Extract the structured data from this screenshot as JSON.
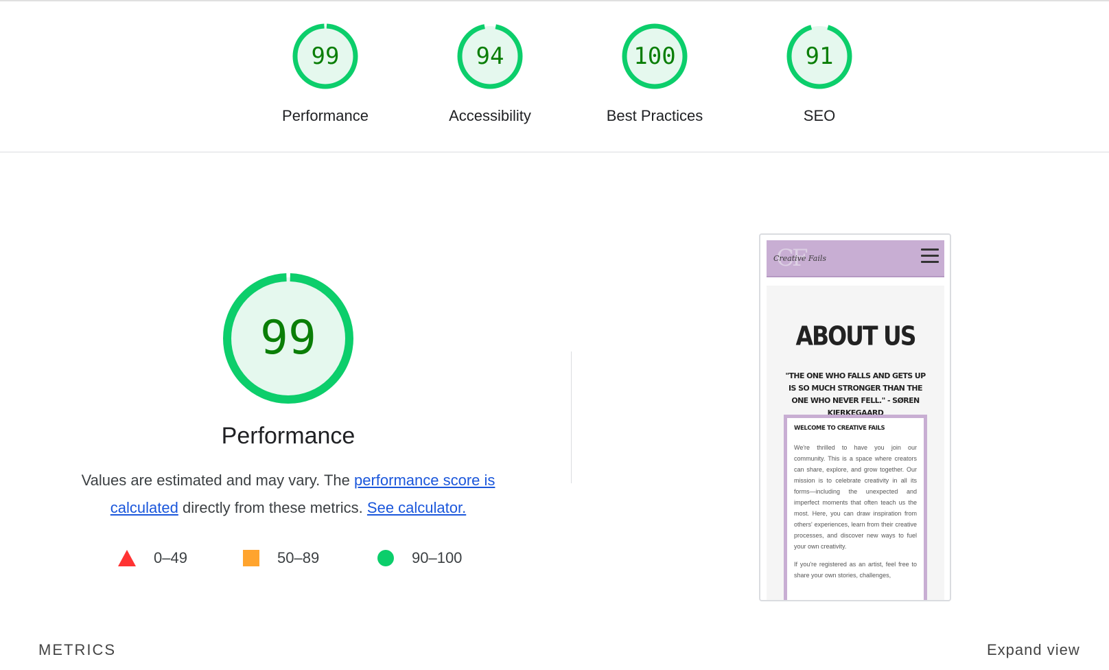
{
  "categories": [
    {
      "score": "99",
      "value": 99,
      "label": "Performance"
    },
    {
      "score": "94",
      "value": 94,
      "label": "Accessibility"
    },
    {
      "score": "100",
      "value": 100,
      "label": "Best Practices"
    },
    {
      "score": "91",
      "value": 91,
      "label": "SEO"
    }
  ],
  "colors": {
    "pass_ring": "#0cce6b",
    "pass_fill": "#e5f8ee",
    "pass_text": "#0a7e07",
    "fail": "#ff3333",
    "average": "#ffa42e",
    "link": "#1a56db"
  },
  "performance": {
    "score": "99",
    "value": 99,
    "title": "Performance",
    "desc_prefix": "Values are estimated and may vary. The ",
    "link_score": "performance score is calculated",
    "desc_middle": " directly from these metrics. ",
    "link_calculator": "See calculator."
  },
  "legend": [
    {
      "icon": "triangle-icon",
      "range": "0–49"
    },
    {
      "icon": "square-icon",
      "range": "50–89"
    },
    {
      "icon": "circle-icon",
      "range": "90–100"
    }
  ],
  "screenshot": {
    "logo_mono": "CF",
    "logo_script": "Creative Fails",
    "heading": "ABOUT US",
    "quote": "\"THE ONE WHO FALLS AND GETS UP IS SO MUCH STRONGER THAN THE ONE WHO NEVER FELL.\" - SØREN KIERKEGAARD",
    "card_title": "WELCOME TO CREATIVE FAILS",
    "card_body": "We're thrilled to have you join our community. This is a space where creators can share, explore, and grow together. Our mission is to celebrate creativity in all its forms—including the unexpected and imperfect moments that often teach us the most. Here, you can draw inspiration from others' experiences, learn from their creative processes, and discover new ways to fuel your own creativity.",
    "card_body2": "If you're registered as an artist, feel free to share your own stories, challenges,"
  },
  "footer": {
    "metrics_label": "METRICS",
    "expand_label": "Expand view"
  }
}
